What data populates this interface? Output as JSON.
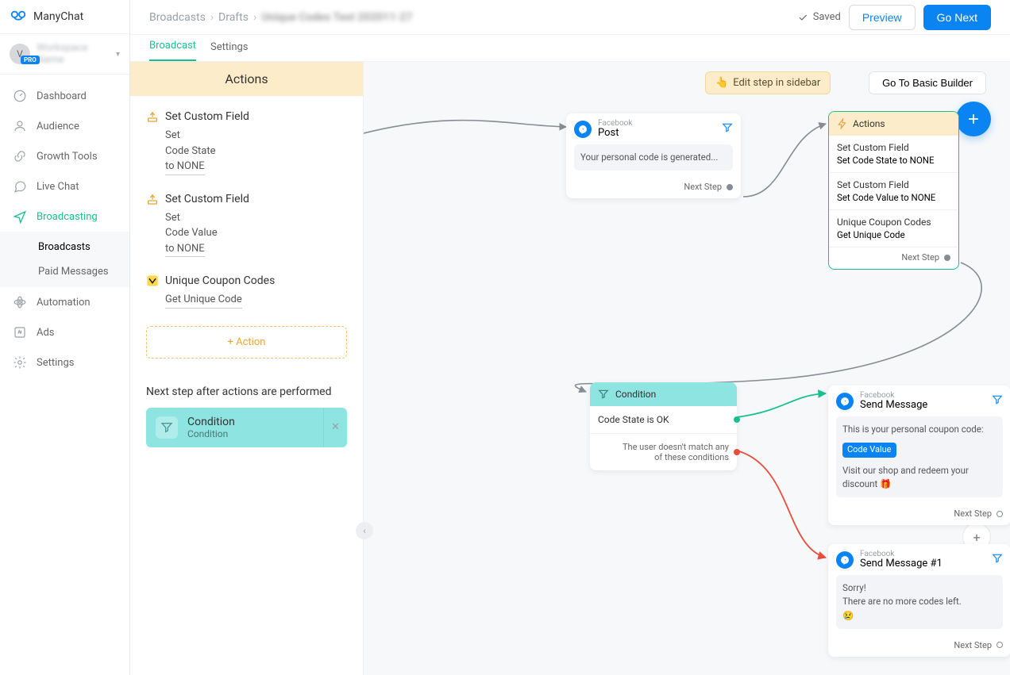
{
  "brand": {
    "name": "ManyChat"
  },
  "account": {
    "name": "Workspace Name",
    "badge": "PRO"
  },
  "nav": {
    "items": [
      {
        "label": "Dashboard"
      },
      {
        "label": "Audience"
      },
      {
        "label": "Growth Tools"
      },
      {
        "label": "Live Chat"
      },
      {
        "label": "Broadcasting"
      },
      {
        "label": "Automation"
      },
      {
        "label": "Ads"
      },
      {
        "label": "Settings"
      }
    ],
    "sub": {
      "broadcasts": "Broadcasts",
      "paid": "Paid Messages"
    }
  },
  "crumbs": {
    "a": "Broadcasts",
    "b": "Drafts",
    "c": "Unique Codes Test 202011-27"
  },
  "top": {
    "saved": "Saved",
    "preview": "Preview",
    "gonext": "Go Next"
  },
  "tabs": {
    "broadcast": "Broadcast",
    "settings": "Settings"
  },
  "panel": {
    "title": "Actions",
    "actions": [
      {
        "title": "Set Custom Field",
        "l1": "Set",
        "l2": "Code State",
        "l3": "to NONE"
      },
      {
        "title": "Set Custom Field",
        "l1": "Set",
        "l2": "Code Value",
        "l3": "to NONE"
      },
      {
        "title": "Unique Coupon Codes",
        "l1": "Get Unique Code"
      }
    ],
    "add_action": "+ Action",
    "next_label": "Next step after actions are performed",
    "next_card": {
      "t1": "Condition",
      "t2": "Condition"
    }
  },
  "canvas": {
    "chip": "Edit step in sidebar",
    "basic": "Go To Basic Builder",
    "post": {
      "platform": "Facebook",
      "title": "Post",
      "msg": "Your personal code is generated...",
      "next": "Next Step"
    },
    "actions": {
      "title": "Actions",
      "rows": [
        {
          "s1": "Set Custom Field",
          "s2": "Set Code State to NONE"
        },
        {
          "s1": "Set Custom Field",
          "s2": "Set Code Value to NONE"
        },
        {
          "s1": "Unique Coupon Codes",
          "s2": "Get Unique Code"
        }
      ],
      "next": "Next Step"
    },
    "cond": {
      "title": "Condition",
      "r1": "Code State is OK",
      "r2a": "The user doesn't match any",
      "r2b": "of these conditions"
    },
    "send1": {
      "platform": "Facebook",
      "title": "Send Message",
      "body1": "This is your personal coupon code:",
      "chip": "Code Value",
      "body2": "Visit our shop and redeem your discount 🎁",
      "next": "Next Step"
    },
    "send2": {
      "platform": "Facebook",
      "title": "Send Message #1",
      "body1": "Sorry!",
      "body2": "There are no more codes left.",
      "body3": "😢",
      "next": "Next Step"
    }
  }
}
